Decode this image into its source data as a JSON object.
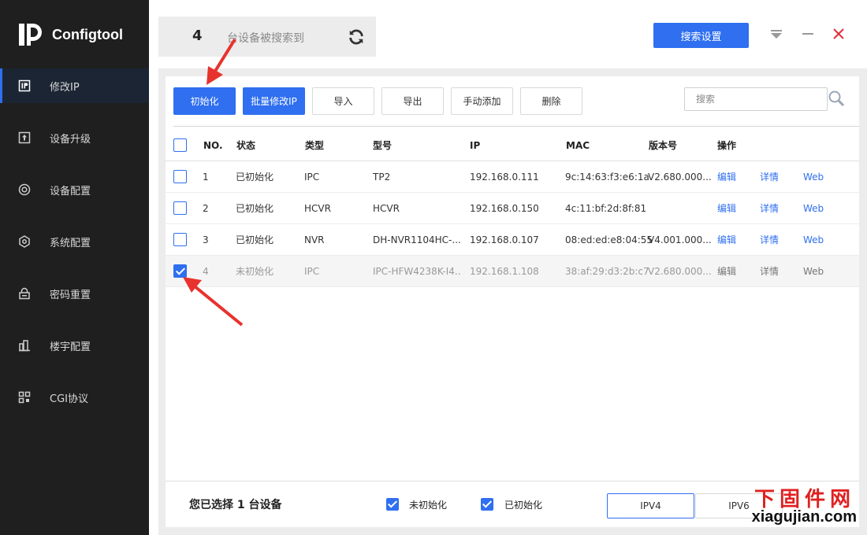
{
  "app": {
    "name": "Configtool"
  },
  "sidebar": {
    "items": [
      {
        "label": "修改IP",
        "icon": "ip-icon",
        "active": true
      },
      {
        "label": "设备升级",
        "icon": "upgrade-icon",
        "active": false
      },
      {
        "label": "设备配置",
        "icon": "device-config-icon",
        "active": false
      },
      {
        "label": "系统配置",
        "icon": "system-config-icon",
        "active": false
      },
      {
        "label": "密码重置",
        "icon": "password-reset-icon",
        "active": false
      },
      {
        "label": "楼宇配置",
        "icon": "building-icon",
        "active": false
      },
      {
        "label": "CGI协议",
        "icon": "cgi-icon",
        "active": false
      }
    ]
  },
  "header": {
    "device_count": "4",
    "count_text": "台设备被搜索到",
    "search_settings_label": "搜索设置"
  },
  "toolbar": {
    "init_label": "初始化",
    "batch_modify_label": "批量修改IP",
    "import_label": "导入",
    "export_label": "导出",
    "manual_add_label": "手动添加",
    "delete_label": "删除",
    "search_placeholder": "搜索"
  },
  "table": {
    "headers": {
      "no": "NO.",
      "status": "状态",
      "type": "类型",
      "model": "型号",
      "ip": "IP",
      "mac": "MAC",
      "version": "版本号",
      "action": "操作"
    },
    "rows": [
      {
        "no": "1",
        "status": "已初始化",
        "type": "IPC",
        "model": "TP2",
        "ip": "192.168.0.111",
        "mac": "9c:14:63:f3:e6:1a",
        "version": "V2.680.000...",
        "edit": "编辑",
        "detail": "详情",
        "web": "Web",
        "checked": false
      },
      {
        "no": "2",
        "status": "已初始化",
        "type": "HCVR",
        "model": "HCVR",
        "ip": "192.168.0.150",
        "mac": "4c:11:bf:2d:8f:81",
        "version": "",
        "edit": "编辑",
        "detail": "详情",
        "web": "Web",
        "checked": false
      },
      {
        "no": "3",
        "status": "已初始化",
        "type": "NVR",
        "model": "DH-NVR1104HC-...",
        "ip": "192.168.0.107",
        "mac": "08:ed:ed:e8:04:55",
        "version": "V4.001.000...",
        "edit": "编辑",
        "detail": "详情",
        "web": "Web",
        "checked": false
      },
      {
        "no": "4",
        "status": "未初始化",
        "type": "IPC",
        "model": "IPC-HFW4238K-I4...",
        "ip": "192.168.1.108",
        "mac": "38:af:29:d3:2b:c7",
        "version": "V2.680.000...",
        "edit": "编辑",
        "detail": "详情",
        "web": "Web",
        "checked": true
      }
    ]
  },
  "footer": {
    "selected_prefix": "您已选择",
    "selected_count": "1",
    "selected_suffix": "台设备",
    "filter_uninit": "未初始化",
    "filter_init": "已初始化",
    "ipv4_label": "IPV4",
    "ipv6_label": "IPV6"
  },
  "watermark": {
    "cn": "下固件网",
    "en": "xiagujian.com"
  },
  "colors": {
    "accent": "#2f6ff0",
    "sidebar_bg": "#1f1f1f",
    "annotation": "#e8322e"
  }
}
